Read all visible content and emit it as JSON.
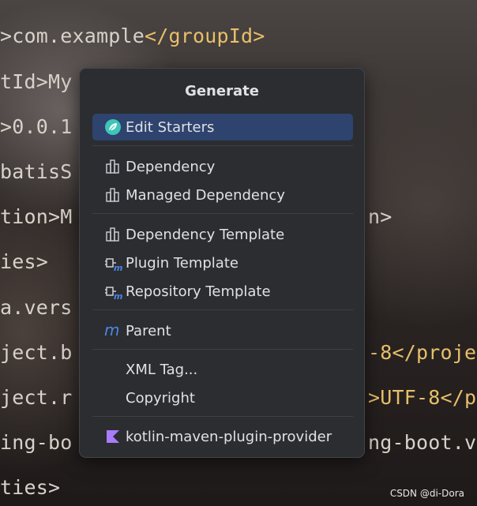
{
  "editor": {
    "lines": [
      {
        "left": ">com.example",
        "tag": "</groupId>",
        "right": ""
      },
      {
        "left": "tId>My",
        "tag": "",
        "right": ""
      },
      {
        "left": ">0.0.1",
        "tag": "",
        "right": ""
      },
      {
        "left": "batisS",
        "tag": "",
        "right": ""
      },
      {
        "left": "tion>M",
        "tag": "",
        "right": "n>"
      },
      {
        "left": "ies>",
        "tag": "",
        "right": ""
      },
      {
        "left": "a.vers",
        "tag": "",
        "right": ""
      },
      {
        "left": "ject.b",
        "tag": "",
        "right": "-8</proje"
      },
      {
        "left": "ject.r",
        "tag": "",
        "right": ">UTF-8</p"
      },
      {
        "left": "ing-bo",
        "tag": "",
        "right": "ng-boot.v"
      },
      {
        "left": "ties>",
        "tag": "",
        "right": ""
      }
    ]
  },
  "popup": {
    "title": "Generate",
    "items": [
      {
        "label": "Edit Starters",
        "icon": "spring-leaf-icon",
        "selected": true
      },
      {
        "label": "Dependency",
        "icon": "dependency-icon"
      },
      {
        "label": "Managed Dependency",
        "icon": "dependency-icon"
      },
      {
        "label": "Dependency Template",
        "icon": "dependency-icon"
      },
      {
        "label": "Plugin Template",
        "icon": "maven-plugin-icon"
      },
      {
        "label": "Repository Template",
        "icon": "maven-plugin-icon"
      },
      {
        "label": "Parent",
        "icon": "maven-m-icon"
      },
      {
        "label": "XML Tag...",
        "icon": ""
      },
      {
        "label": "Copyright",
        "icon": ""
      },
      {
        "label": "kotlin-maven-plugin-provider",
        "icon": "kotlin-icon"
      }
    ]
  },
  "watermark": "CSDN @di-Dora",
  "colors": {
    "popup_bg": "#2b2d30",
    "selection": "#2e436e",
    "xml_tag": "#e8bf6a",
    "maven_blue": "#4a86e8",
    "kotlin": "#a97bff",
    "spring_green": "#3ec6b8"
  }
}
